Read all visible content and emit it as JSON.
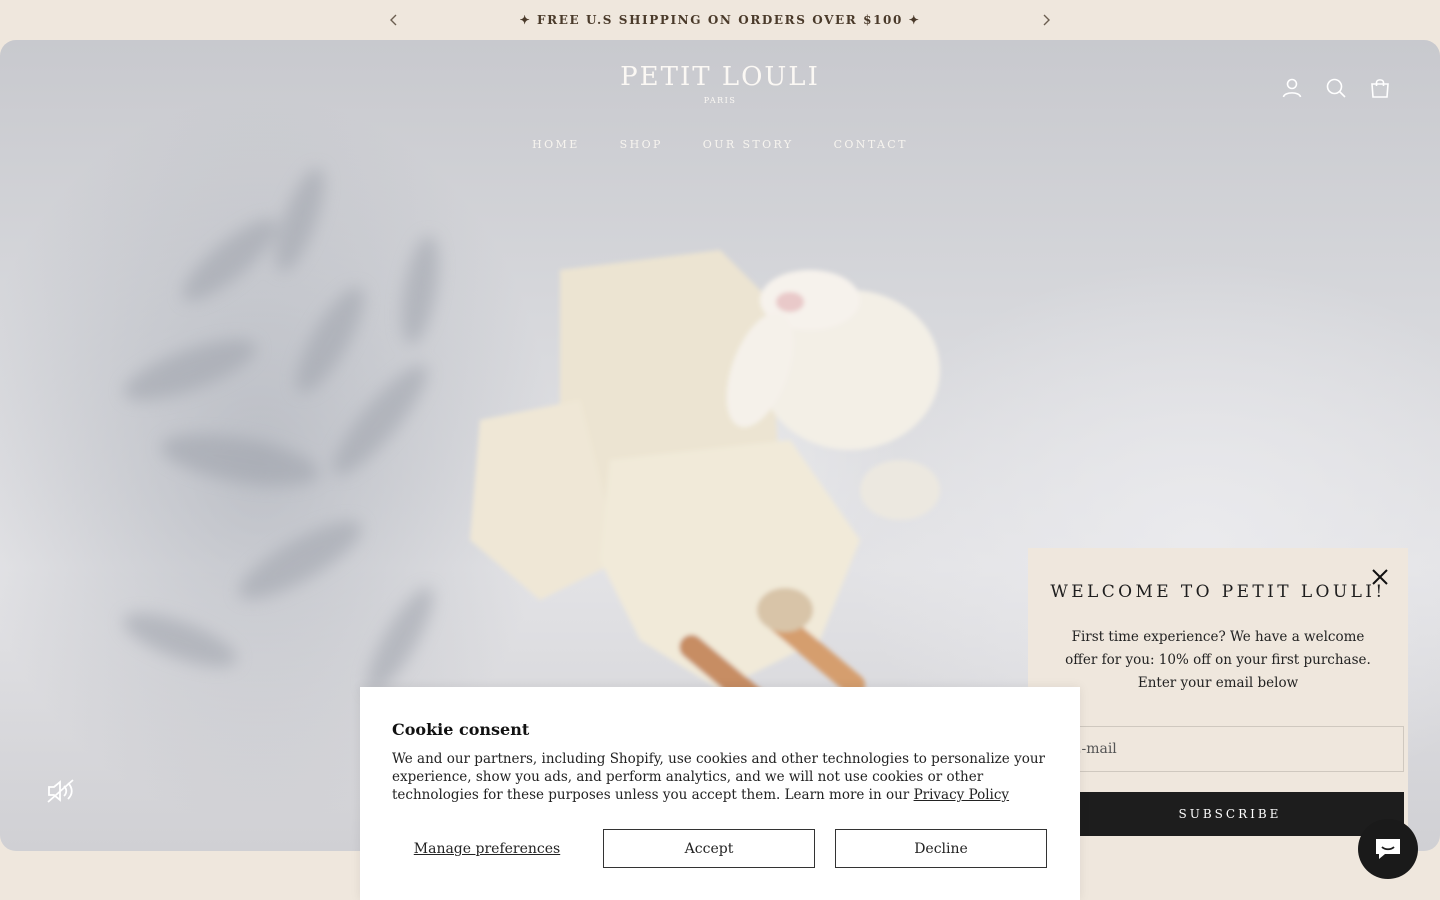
{
  "announcement": {
    "text": "✦ FREE U.S SHIPPING ON ORDERS OVER $100 ✦"
  },
  "header": {
    "logo_main": "PETIT LOULI",
    "logo_sub": "PARIS",
    "nav": [
      "HOME",
      "SHOP",
      "OUR STORY",
      "CONTACT"
    ],
    "icons": [
      "account-icon",
      "search-icon",
      "cart-icon"
    ]
  },
  "hero": {
    "mute_icon": "volume-muted-icon"
  },
  "popup": {
    "title": "WELCOME TO PETIT LOULI!",
    "body": "First time experience? We have a welcome offer for you: 10% off on your first purchase. Enter your email below",
    "email_placeholder": "E-mail",
    "subscribe_label": "SUBSCRIBE"
  },
  "cookie": {
    "title": "Cookie consent",
    "text": "We and our partners, including Shopify, use cookies and other technologies to personalize your experience, show you ads, and perform analytics, and we will not use cookies or other technologies for these purposes unless you accept them. Learn more in our ",
    "link": "Privacy Policy",
    "manage_label": "Manage preferences",
    "accept_label": "Accept",
    "decline_label": "Decline"
  },
  "chat": {
    "icon": "chat-icon"
  },
  "colors": {
    "announcement_bg": "#efe7dd",
    "announcement_text": "#4a3a2a",
    "button_dark": "#1d1d1d"
  }
}
